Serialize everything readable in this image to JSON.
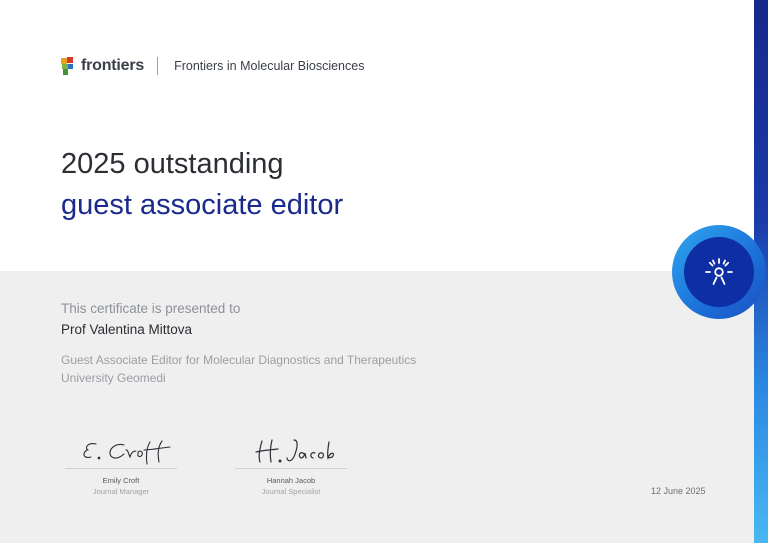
{
  "header": {
    "brand": "frontiers",
    "journal": "Frontiers in Molecular Biosciences"
  },
  "title": {
    "line1": "2025 outstanding",
    "line2": "guest associate editor"
  },
  "certificate": {
    "presented_to": "This certificate is presented to",
    "recipient": "Prof Valentina Mittova",
    "role": "Guest Associate Editor for Molecular Diagnostics and Therapeutics",
    "institution": "University Geomedi"
  },
  "signatures": [
    {
      "name": "Emily Croft",
      "title": "Journal Manager"
    },
    {
      "name": "Hannah Jacob",
      "title": "Journal Specialist"
    }
  ],
  "date": "12 June 2025",
  "colors": {
    "accent_blue": "#1a2a8c",
    "badge_dark": "#0d2fa3",
    "badge_light": "#2fa7ee",
    "panel_gray": "#efefef"
  },
  "icons": {
    "logo": "frontiers-logo-icon",
    "badge": "outstanding-badge-icon"
  }
}
